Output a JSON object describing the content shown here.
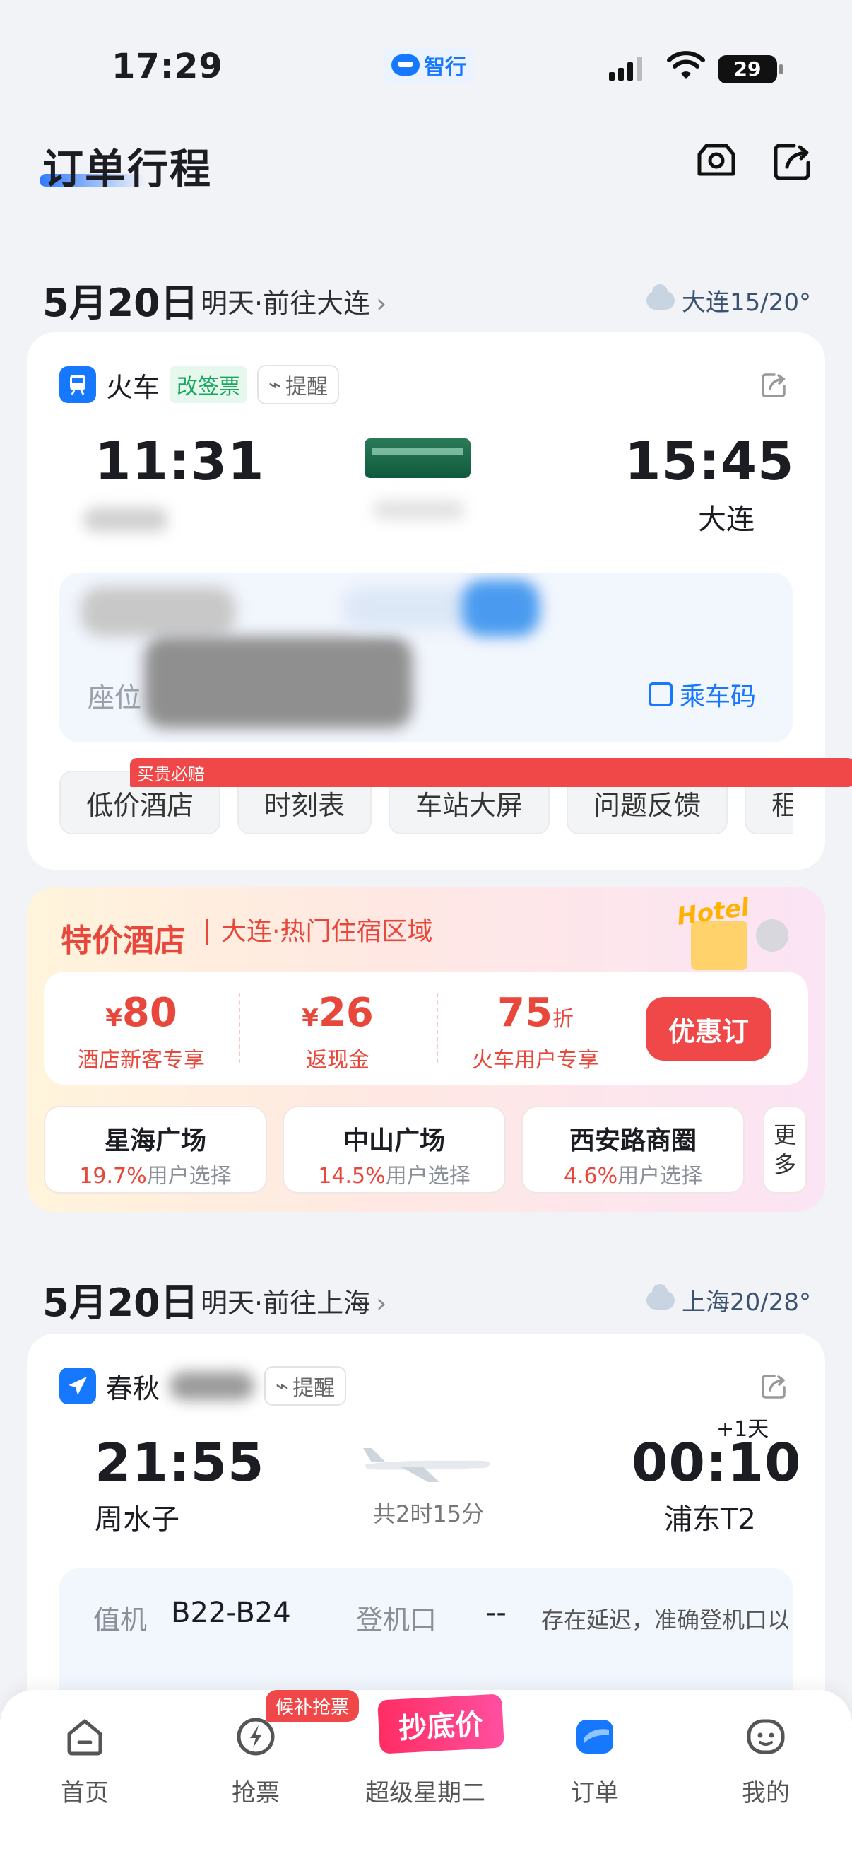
{
  "status_bar": {
    "time": "17:29",
    "app_name": "智行",
    "battery": "29"
  },
  "header": {
    "title": "订单行程"
  },
  "trip1": {
    "date": "5月20日",
    "subtitle": "明天·前往大连",
    "weather": "大连15/20°",
    "type_label": "火车",
    "tag": "改签票",
    "remind": "提醒",
    "depart_time": "11:31",
    "arrive_time": "15:45",
    "arrive_city": "大连",
    "seat_label": "座位",
    "ride_code": "乘车码",
    "chips": [
      "低价酒店",
      "时刻表",
      "车站大屏",
      "问题反馈",
      "租"
    ],
    "chip_badge": "买贵必赔"
  },
  "hotel": {
    "title": "特价酒店",
    "subtitle": "大连·热门住宿区域",
    "sign": "Hotel",
    "offers": [
      {
        "currency": "¥",
        "amount": "80",
        "unit": "",
        "desc": "酒店新客专享"
      },
      {
        "currency": "¥",
        "amount": "26",
        "unit": "",
        "desc": "返现金"
      },
      {
        "currency": "",
        "amount": "75",
        "unit": "折",
        "desc": "火车用户专享"
      }
    ],
    "book_button": "优惠订",
    "areas": [
      {
        "name": "星海广场",
        "percent": "19.7%",
        "suffix": "用户选择"
      },
      {
        "name": "中山广场",
        "percent": "14.5%",
        "suffix": "用户选择"
      },
      {
        "name": "西安路商圈",
        "percent": "4.6%",
        "suffix": "用户选择"
      }
    ],
    "more": "更多"
  },
  "trip2": {
    "date": "5月20日",
    "subtitle": "明天·前往上海",
    "weather": "上海20/28°",
    "airline": "春秋",
    "remind": "提醒",
    "depart_time": "21:55",
    "depart_airport": "周水子",
    "arrive_time": "00:10",
    "plus_day": "+1天",
    "arrive_airport": "浦东T2",
    "duration": "共2时15分",
    "checkin_label": "值机",
    "checkin_value": "B22-B24",
    "gate_label": "登机口",
    "gate_value": "--",
    "gate_note": "存在延迟，准确登机口以"
  },
  "tabs": [
    {
      "label": "首页"
    },
    {
      "label": "抢票"
    },
    {
      "label": "超级星期二"
    },
    {
      "label": "订单"
    },
    {
      "label": "我的"
    }
  ],
  "tab_badge": "候补抢票",
  "promo_logo": "抄底价",
  "accent_color": "#1677ff",
  "promo_color": "#e8473b"
}
